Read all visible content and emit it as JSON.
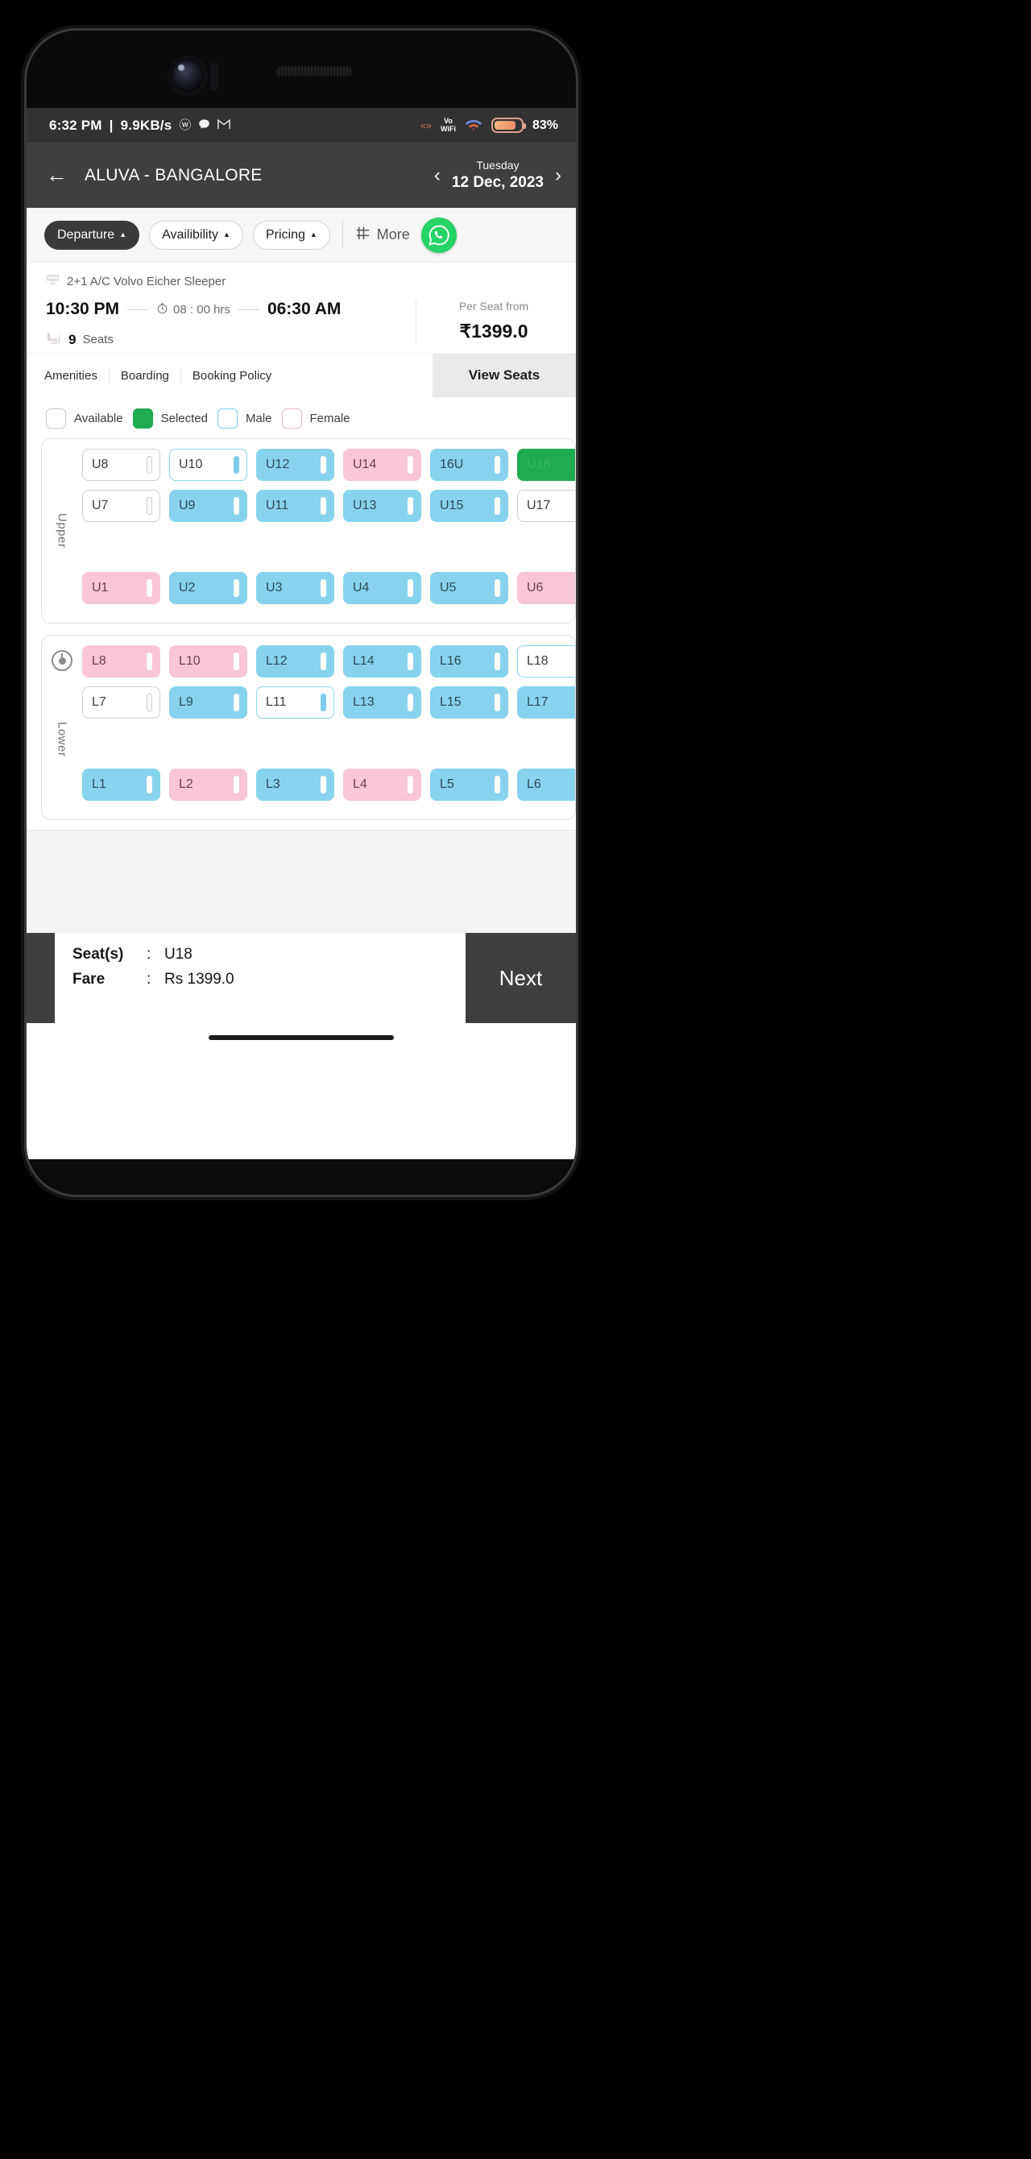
{
  "statusbar": {
    "time": "6:32 PM",
    "separator": "|",
    "netspeed": "9.9KB/s",
    "icons": [
      "whatsapp-icon",
      "chat-icon",
      "gmail-icon"
    ],
    "whatsapp_glyph": "ⓦ",
    "chat_glyph": "●",
    "gmail_glyph": "M",
    "signal_glyph": "«»",
    "volte_line1": "Vo",
    "volte_line2": "WiFi",
    "battery_percent": "83%",
    "battery_level": 83
  },
  "header": {
    "back_icon": "←",
    "route": "ALUVA - BANGALORE",
    "prev_icon": "‹",
    "next_icon": "›",
    "day_of_week": "Tuesday",
    "date": "12 Dec, 2023"
  },
  "filters": {
    "chips": [
      {
        "label": "Departure",
        "active": true,
        "caret": "▲"
      },
      {
        "label": "Availibility",
        "active": false,
        "caret": "▲"
      },
      {
        "label": "Pricing",
        "active": false,
        "caret": "▲"
      }
    ],
    "more_label": "More",
    "more_icon": "sliders-icon",
    "whatsapp_label": "whatsapp-button"
  },
  "bus": {
    "type": "2+1 A/C Volvo Eicher Sleeper",
    "departure_time": "10:30 PM",
    "duration": "08 : 00 hrs",
    "arrival_time": "06:30 AM",
    "seats_available_count": "9",
    "seats_available_label": "Seats",
    "price_label": "Per Seat from",
    "price": "₹1399.0"
  },
  "tabs": {
    "items": [
      "Amenities",
      "Boarding",
      "Booking Policy"
    ],
    "active_tab": "View Seats"
  },
  "legend": [
    {
      "label": "Available",
      "state": "available"
    },
    {
      "label": "Selected",
      "state": "selected"
    },
    {
      "label": "Male",
      "state": "male"
    },
    {
      "label": "Female",
      "state": "female"
    }
  ],
  "seatmap": {
    "upper_label": "Upper",
    "lower_label": "Lower",
    "decks": [
      {
        "id": "upper",
        "label": "Upper",
        "rows": [
          {
            "gap_after": false,
            "seats": [
              {
                "id": "U8",
                "state": "available"
              },
              {
                "id": "U10",
                "state": "available-blue"
              },
              {
                "id": "U12",
                "state": "male"
              },
              {
                "id": "U14",
                "state": "female"
              },
              {
                "id": "16U",
                "state": "male"
              },
              {
                "id": "U18",
                "state": "selected"
              }
            ]
          },
          {
            "gap_after": true,
            "seats": [
              {
                "id": "U7",
                "state": "available"
              },
              {
                "id": "U9",
                "state": "male"
              },
              {
                "id": "U11",
                "state": "male"
              },
              {
                "id": "U13",
                "state": "male"
              },
              {
                "id": "U15",
                "state": "male"
              },
              {
                "id": "U17",
                "state": "available"
              }
            ]
          },
          {
            "gap_after": false,
            "seats": [
              {
                "id": "U1",
                "state": "female"
              },
              {
                "id": "U2",
                "state": "male"
              },
              {
                "id": "U3",
                "state": "male"
              },
              {
                "id": "U4",
                "state": "male"
              },
              {
                "id": "U5",
                "state": "male"
              },
              {
                "id": "U6",
                "state": "female"
              }
            ]
          }
        ]
      },
      {
        "id": "lower",
        "label": "Lower",
        "rows": [
          {
            "gap_after": false,
            "seats": [
              {
                "id": "L8",
                "state": "female"
              },
              {
                "id": "L10",
                "state": "female"
              },
              {
                "id": "L12",
                "state": "male"
              },
              {
                "id": "L14",
                "state": "male"
              },
              {
                "id": "L16",
                "state": "male"
              },
              {
                "id": "L18",
                "state": "available-blue"
              }
            ]
          },
          {
            "gap_after": true,
            "seats": [
              {
                "id": "L7",
                "state": "available"
              },
              {
                "id": "L9",
                "state": "male"
              },
              {
                "id": "L11",
                "state": "available-blue"
              },
              {
                "id": "L13",
                "state": "male"
              },
              {
                "id": "L15",
                "state": "male"
              },
              {
                "id": "L17",
                "state": "male"
              }
            ]
          },
          {
            "gap_after": false,
            "seats": [
              {
                "id": "L1",
                "state": "male"
              },
              {
                "id": "L2",
                "state": "female"
              },
              {
                "id": "L3",
                "state": "male"
              },
              {
                "id": "L4",
                "state": "female"
              },
              {
                "id": "L5",
                "state": "male"
              },
              {
                "id": "L6",
                "state": "male"
              }
            ]
          }
        ]
      }
    ]
  },
  "footer": {
    "seats_key": "Seat(s)",
    "seats_sep": ":",
    "seats_value": "U18",
    "fare_key": "Fare",
    "fare_sep": ":",
    "fare_value": "Rs 1399.0",
    "next_label": "Next"
  },
  "colors": {
    "selected_green": "#1fab4f",
    "male_blue": "#87d3ee",
    "female_pink": "#f8c6d5",
    "header_gray": "#3f3f3f",
    "whatsapp_green": "#25D366"
  }
}
